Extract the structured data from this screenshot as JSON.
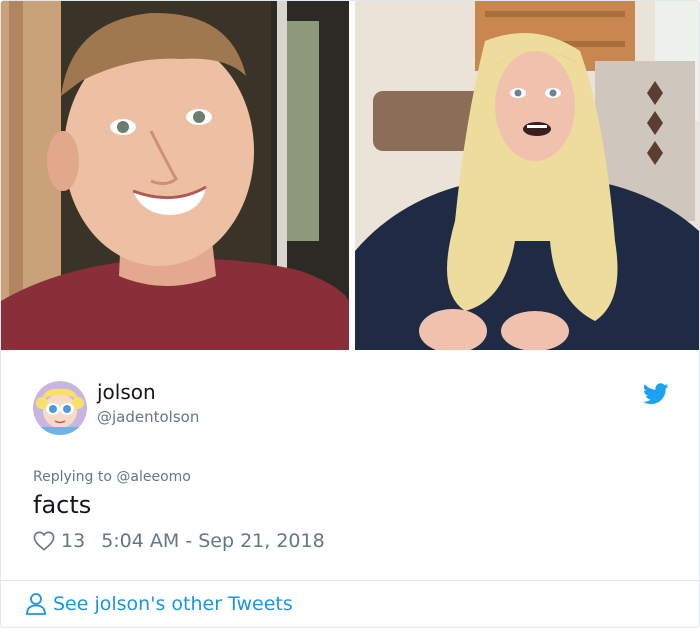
{
  "tweet": {
    "display_name": "jolson",
    "handle": "@jadentolson",
    "replying_prefix": "Replying to ",
    "replying_to": "@aleeomo",
    "text": "facts",
    "likes": "13",
    "timestamp": "5:04 AM - Sep 21, 2018",
    "more_link": "See jolson's other Tweets"
  },
  "icons": {
    "brand": "twitter-bird-icon",
    "like": "heart-icon",
    "profile": "person-icon"
  },
  "colors": {
    "link_blue": "#1b95e0",
    "twitter_blue": "#1da1f2",
    "muted_text": "#657786",
    "primary_text": "#14171a",
    "border": "#e1e8ed"
  }
}
